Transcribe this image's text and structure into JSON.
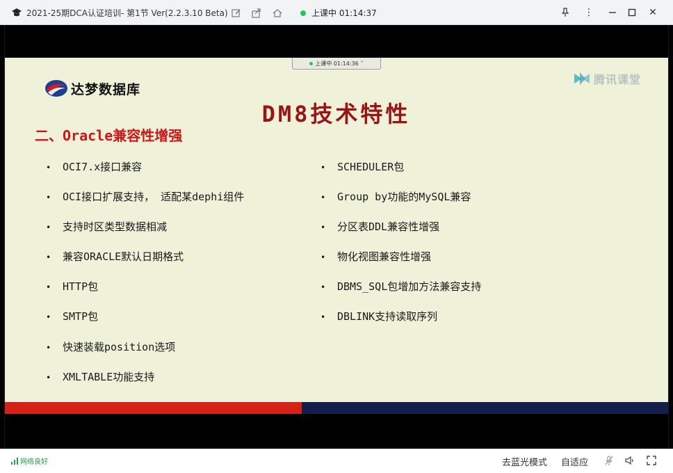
{
  "window": {
    "title": "2021-25期DCA认证培训- 第1节 Ver(2.2.3.10 Beta)",
    "live_status": "上课中 01:14:37",
    "tools": [
      "edit-icon",
      "share-icon",
      "home-icon"
    ],
    "controls": [
      "pin-icon",
      "more-icon",
      "minimize-icon",
      "maximize-icon",
      "close-icon"
    ]
  },
  "video": {
    "floating_timer": "上课中 01:14:36",
    "floating_timer_caret": "˅",
    "watermark": "腾讯课堂"
  },
  "slide": {
    "brand": "达梦数据库",
    "title": "DM8技术特性",
    "section": "二、Oracle兼容性增强",
    "bullet_symbol": "•",
    "left_items": [
      "OCI7.x接口兼容",
      "OCI接口扩展支持， 适配某dephi组件",
      "支持时区类型数据相减",
      "兼容ORACLE默认日期格式",
      "HTTP包",
      "SMTP包",
      "快速装载position选项",
      "XMLTABLE功能支持"
    ],
    "right_items": [
      "SCHEDULER包",
      "Group by功能的MySQL兼容",
      "分区表DDL兼容性增强",
      "物化视图兼容性增强",
      "DBMS_SQL包增加方法兼容支持",
      "DBLINK支持读取序列"
    ],
    "colors": {
      "title": "#9a1414",
      "section": "#d01515",
      "bar_left": "#d42314",
      "bar_right": "#141e4a",
      "background": "#eff1d9"
    }
  },
  "statusbar": {
    "network": "网络良好",
    "blue_light_mode": "去蓝光模式",
    "auto_fit": "自适应",
    "icons": [
      "mic-off-icon",
      "volume-icon",
      "fullscreen-icon"
    ]
  }
}
